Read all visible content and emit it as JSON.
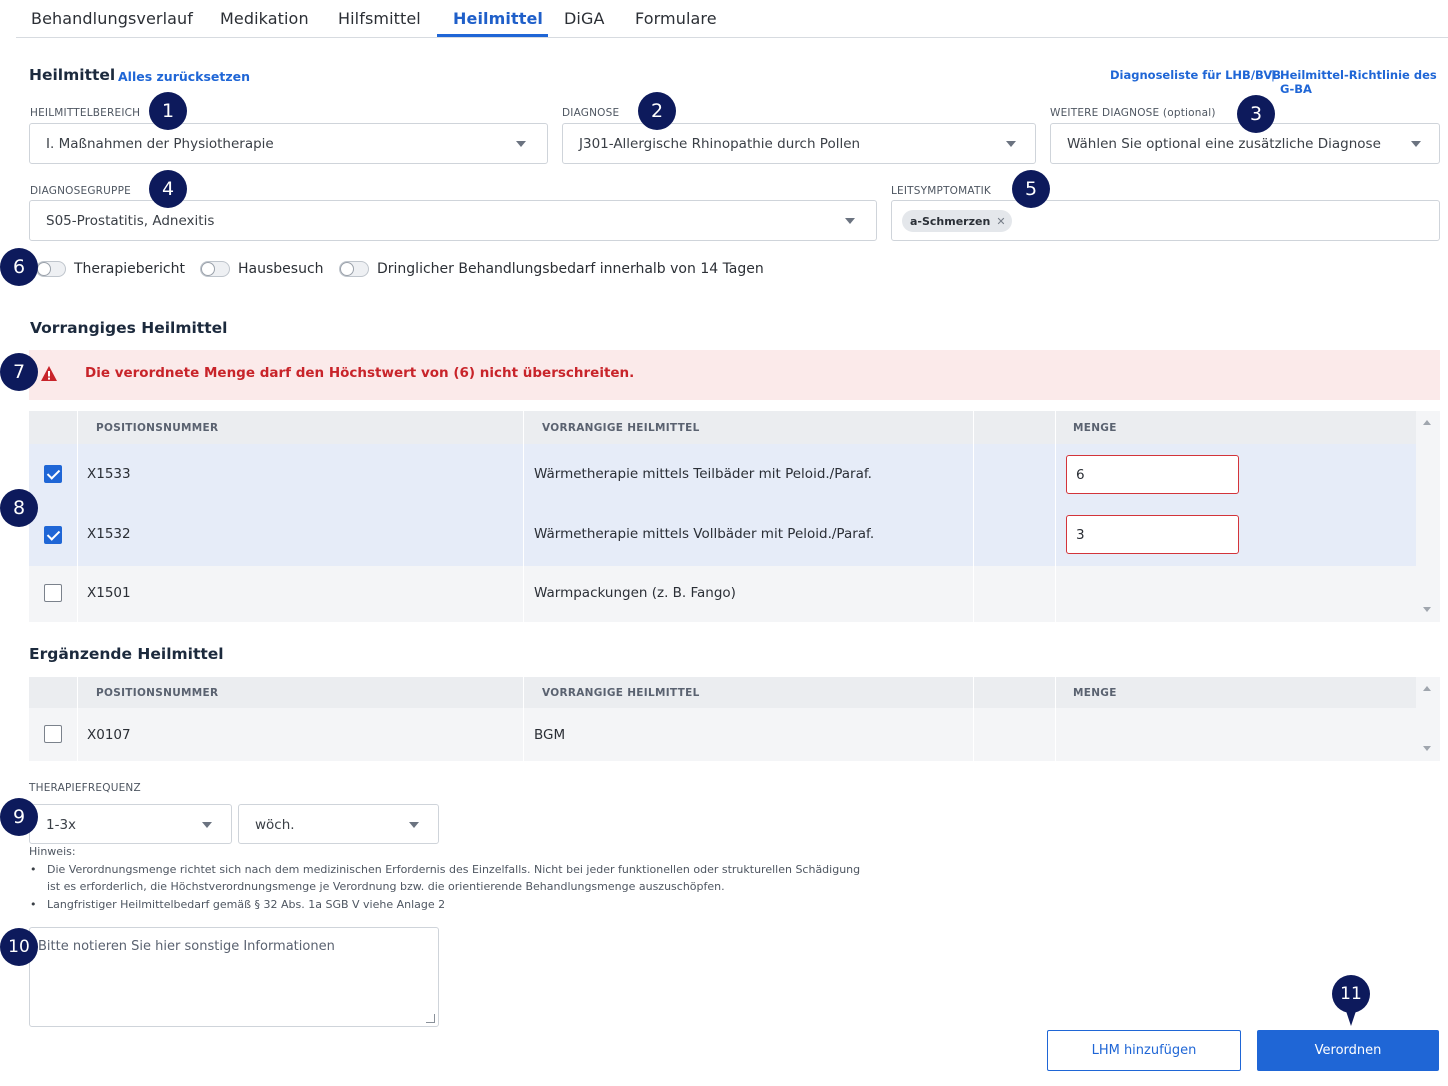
{
  "tabs": [
    {
      "label": "Behandlungsverlauf",
      "active": false
    },
    {
      "label": "Medikation",
      "active": false
    },
    {
      "label": "Hilfsmittel",
      "active": false
    },
    {
      "label": "Heilmittel",
      "active": true
    },
    {
      "label": "DiGA",
      "active": false
    },
    {
      "label": "Formulare",
      "active": false
    }
  ],
  "header": {
    "title": "Heilmittel",
    "reset_link": "Alles zurücksetzen",
    "link_diagnoseliste": "Diagnoseliste für LHB/BVB",
    "separator": "|",
    "link_richtlinie": "Heilmittel-Richtlinie des G-BA"
  },
  "fields": {
    "heilmittelbereich": {
      "label": "HEILMITTELBEREICH",
      "value": "I. Maßnahmen der Physiotherapie"
    },
    "diagnose": {
      "label": "DIAGNOSE",
      "value": "J301-Allergische Rhinopathie durch Pollen"
    },
    "weitere_diagnose": {
      "label": "WEITERE DIAGNOSE",
      "label_optional": "(optional)",
      "value": "Wählen Sie optional eine zusätzliche Diagnose"
    },
    "diagnosegruppe": {
      "label": "DIAGNOSEGRUPPE",
      "value": "S05-Prostatitis, Adnexitis"
    },
    "leitsymptomatik": {
      "label": "LEITSYMPTOMATIK",
      "chips": [
        "a-Schmerzen"
      ],
      "chip_remove": "✕"
    }
  },
  "toggles": [
    {
      "label": "Therapiebericht",
      "on": false
    },
    {
      "label": "Hausbesuch",
      "on": false
    },
    {
      "label": "Dringlicher Behandlungsbedarf innerhalb von 14 Tagen",
      "on": false
    }
  ],
  "vorrangig": {
    "title": "Vorrangiges Heilmittel",
    "alert": "Die verordnete Menge darf den Höchstwert von (6) nicht überschreiten.",
    "alert_icon": "warning-icon",
    "columns": [
      "POSITIONSNUMMER",
      "VORRANGIGE HEILMITTEL",
      "",
      "MENGE"
    ],
    "rows": [
      {
        "checked": true,
        "pos": "X1533",
        "name": "Wärmetherapie mittels Teilbäder mit Peloid./Paraf.",
        "menge": "6"
      },
      {
        "checked": true,
        "pos": "X1532",
        "name": "Wärmetherapie mittels Vollbäder mit Peloid./Paraf.",
        "menge": "3"
      },
      {
        "checked": false,
        "pos": "X1501",
        "name": "Warmpackungen (z. B. Fango)",
        "menge": ""
      }
    ]
  },
  "ergaenzend": {
    "title": "Ergänzende Heilmittel",
    "columns": [
      "POSITIONSNUMMER",
      "VORRANGIGE HEILMITTEL",
      "",
      "MENGE"
    ],
    "rows": [
      {
        "checked": false,
        "pos": "X0107",
        "name": "BGM",
        "menge": ""
      }
    ]
  },
  "therapiefrequenz": {
    "label": "THERAPIEFREQUENZ",
    "count": "1-3x",
    "unit": "wöch."
  },
  "hint": {
    "title": "Hinweis:",
    "items": [
      "Die Verordnungsmenge richtet sich nach dem medizinischen Erfordernis des Einzelfalls. Nicht bei jeder funktionellen oder strukturellen Schädigung",
      "ist es erforderlich, die Höchstverordnungsmenge je Verordnung bzw. die orientierende Behandlungsmenge auszuschöpfen.",
      "Langfristiger Heilmittelbedarf gemäß § 32 Abs. 1a SGB V viehe Anlage 2"
    ]
  },
  "notes": {
    "placeholder": "Bitte notieren Sie hier sonstige Informationen"
  },
  "buttons": {
    "lhm": "LHM hinzufügen",
    "verordnen": "Verordnen"
  },
  "badges": [
    "1",
    "2",
    "3",
    "4",
    "5",
    "6",
    "7",
    "8",
    "9",
    "10",
    "11"
  ],
  "colors": {
    "accent": "#1f66d6",
    "badge": "#0d1a5c",
    "error": "#c8242a",
    "alert_bg": "#fbeaea",
    "selected_row": "#e6ecf8"
  }
}
